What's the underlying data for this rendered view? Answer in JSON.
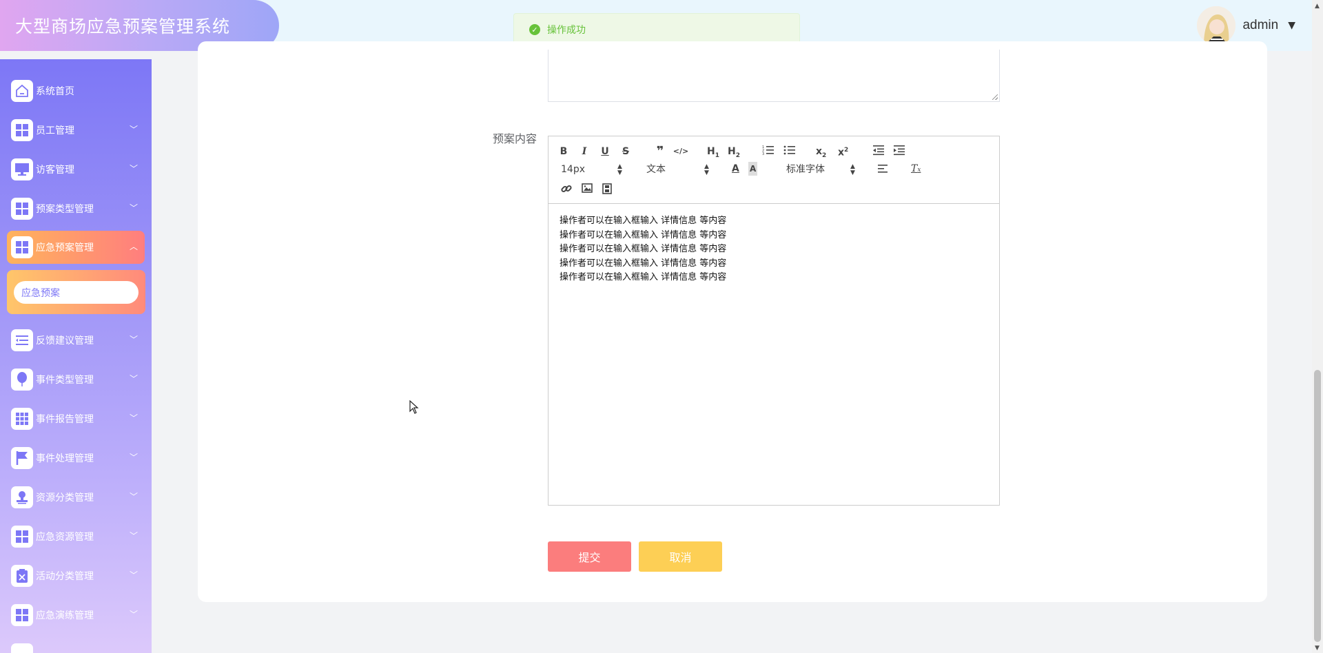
{
  "app": {
    "title": "大型商场应急预案管理系统"
  },
  "header": {
    "username": "admin"
  },
  "toast": {
    "message": "操作成功",
    "color": "#67c23a"
  },
  "sidebar": {
    "items": [
      {
        "label": "系统首页",
        "icon": "home-icon"
      },
      {
        "label": "员工管理",
        "icon": "grid-icon"
      },
      {
        "label": "访客管理",
        "icon": "monitor-icon"
      },
      {
        "label": "预案类型管理",
        "icon": "grid-icon"
      },
      {
        "label": "应急预案管理",
        "icon": "grid-icon",
        "active": true
      },
      {
        "label": "反馈建议管理",
        "icon": "list-icon"
      },
      {
        "label": "事件类型管理",
        "icon": "balloon-icon"
      },
      {
        "label": "事件报告管理",
        "icon": "apps-icon"
      },
      {
        "label": "事件处理管理",
        "icon": "flag-icon"
      },
      {
        "label": "资源分类管理",
        "icon": "stamp-icon"
      },
      {
        "label": "应急资源管理",
        "icon": "grid-icon"
      },
      {
        "label": "活动分类管理",
        "icon": "clipboard-x-icon"
      },
      {
        "label": "应急演练管理",
        "icon": "grid-icon"
      }
    ],
    "submenu": {
      "label": "应急预案"
    }
  },
  "form": {
    "content_label": "预案内容",
    "toolbar": {
      "font_size": "14px",
      "paragraph": "文本",
      "font_family": "标准字体",
      "h1": "H1",
      "h2": "H2"
    },
    "content_lines": [
      "操作者可以在输入框输入  详情信息  等内容",
      "操作者可以在输入框输入  详情信息  等内容",
      "操作者可以在输入框输入  详情信息  等内容",
      "操作者可以在输入框输入  详情信息  等内容",
      "操作者可以在输入框输入  详情信息  等内容"
    ],
    "submit_label": "提交",
    "cancel_label": "取消"
  },
  "colors": {
    "sidebar_top": "#7d77f6",
    "active_gradient_start": "#ffb35c",
    "active_gradient_end": "#ff7e7e",
    "submit": "#fb7d7d",
    "cancel": "#fdcf55"
  }
}
